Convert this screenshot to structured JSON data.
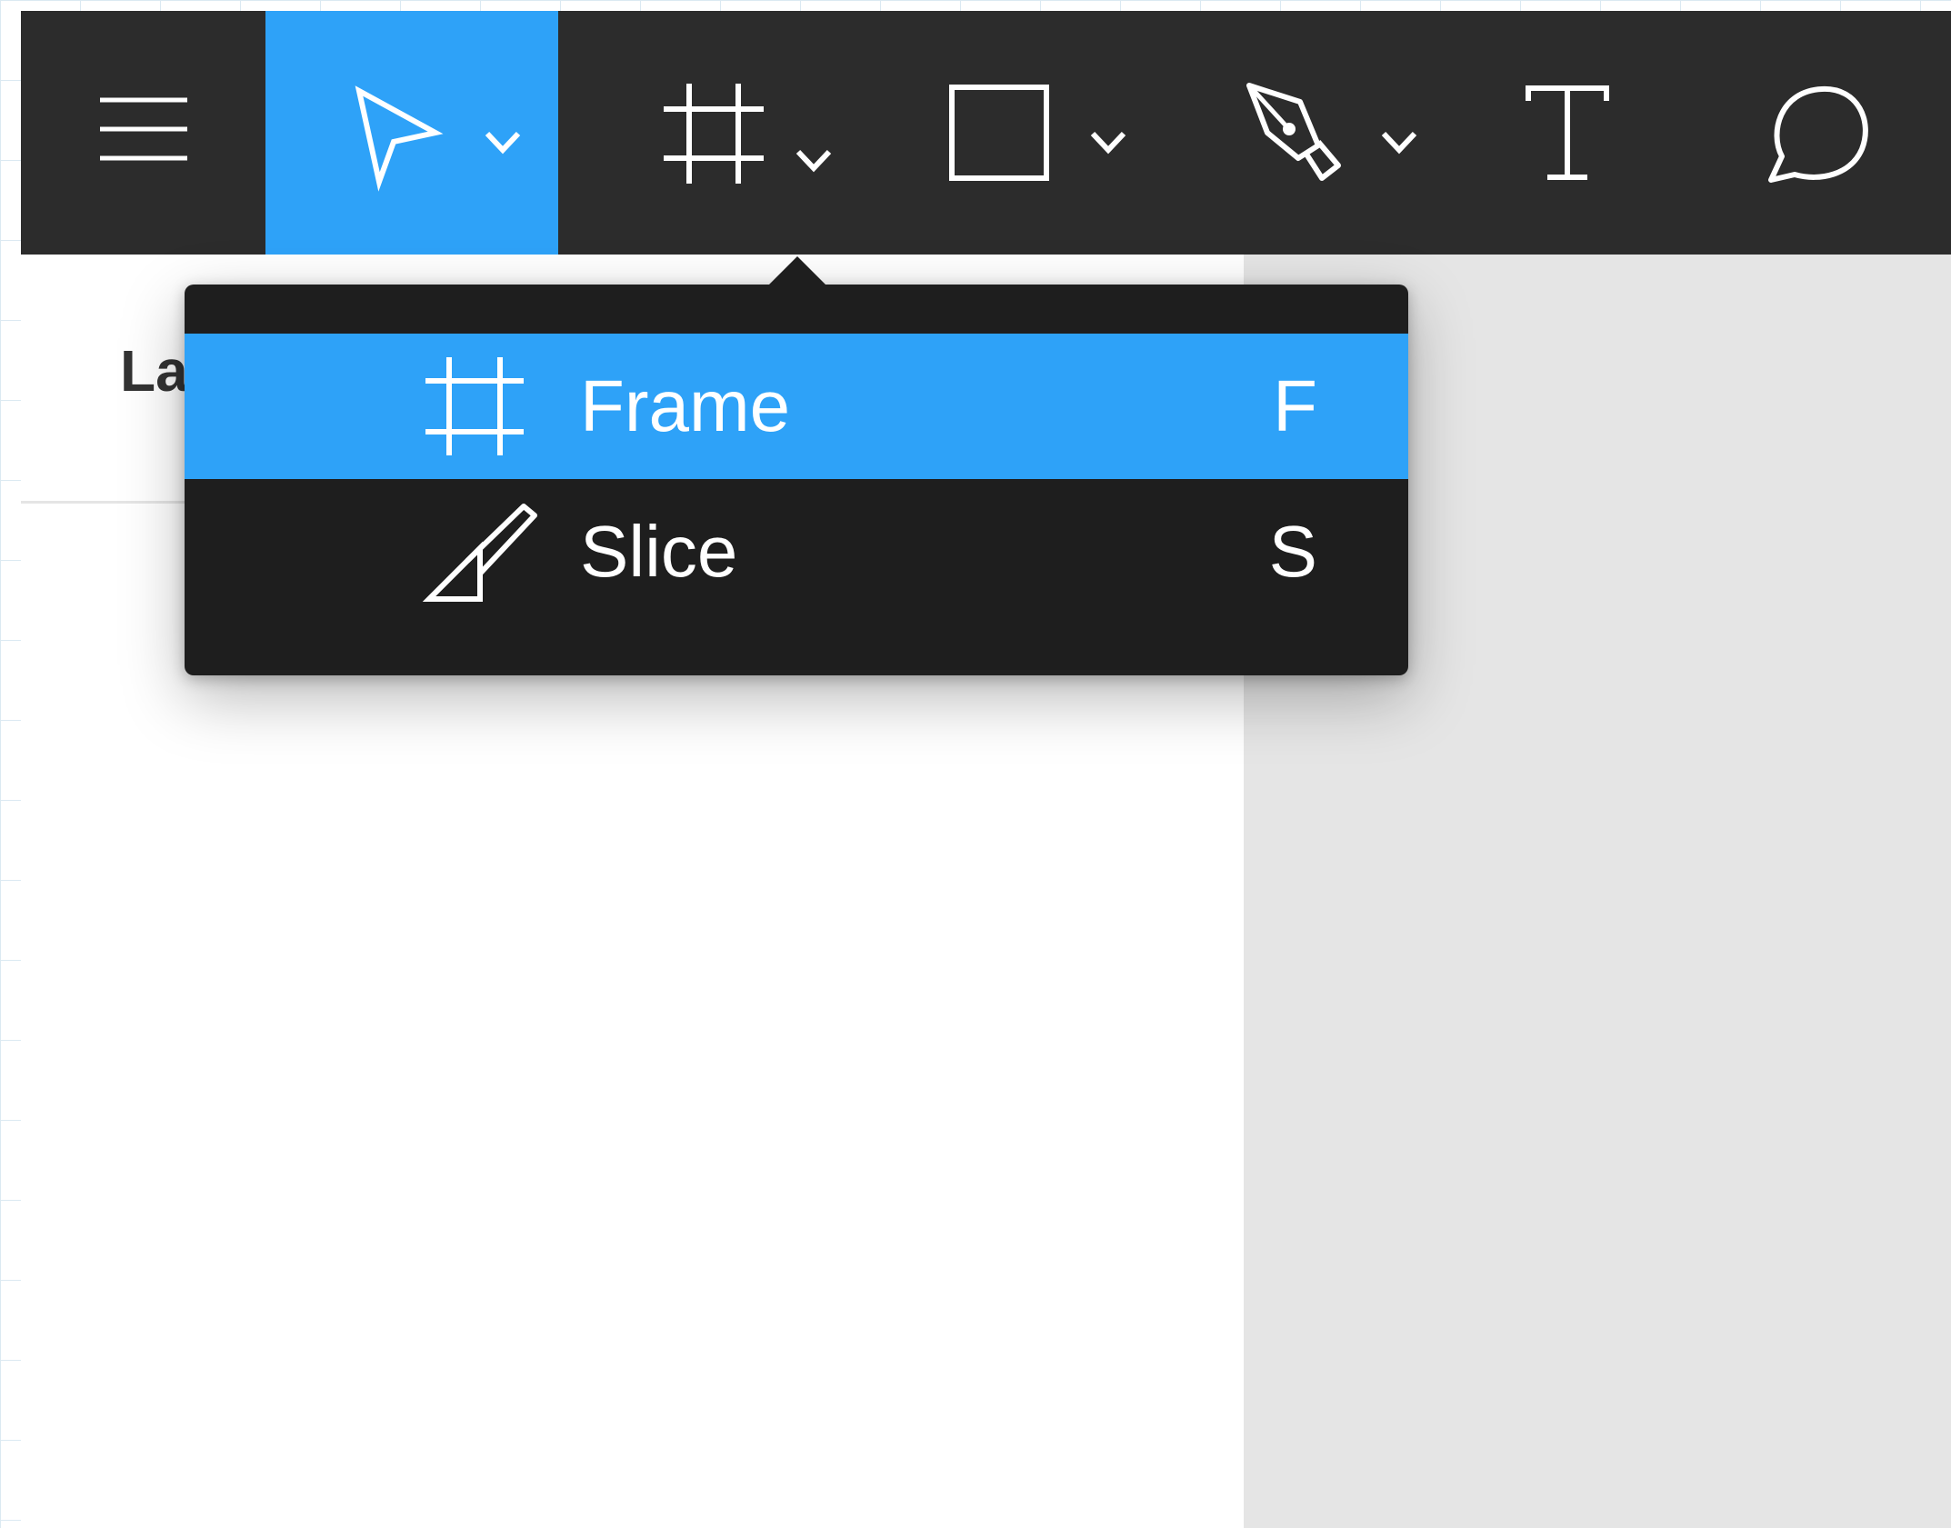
{
  "colors": {
    "accent": "#2ea2f8",
    "toolbar_bg": "#2c2c2c",
    "dropdown_bg": "#1e1e1e",
    "canvas_bg": "#e5e5e5"
  },
  "toolbar": {
    "tools": [
      {
        "name": "menu",
        "icon": "hamburger-menu-icon",
        "has_dropdown": false,
        "active": false
      },
      {
        "name": "move",
        "icon": "move-cursor-icon",
        "has_dropdown": true,
        "active": true
      },
      {
        "name": "frame",
        "icon": "frame-icon",
        "has_dropdown": true,
        "active": false
      },
      {
        "name": "shape",
        "icon": "rectangle-icon",
        "has_dropdown": true,
        "active": false
      },
      {
        "name": "pen",
        "icon": "pen-icon",
        "has_dropdown": true,
        "active": false
      },
      {
        "name": "text",
        "icon": "text-icon",
        "has_dropdown": false,
        "active": false
      },
      {
        "name": "comment",
        "icon": "comment-bubble-icon",
        "has_dropdown": false,
        "active": false
      }
    ]
  },
  "left_panel": {
    "tab_label": "La"
  },
  "dropdown": {
    "items": [
      {
        "label": "Frame",
        "shortcut": "F",
        "icon": "frame-icon",
        "highlighted": true
      },
      {
        "label": "Slice",
        "shortcut": "S",
        "icon": "slice-knife-icon",
        "highlighted": false
      }
    ]
  }
}
